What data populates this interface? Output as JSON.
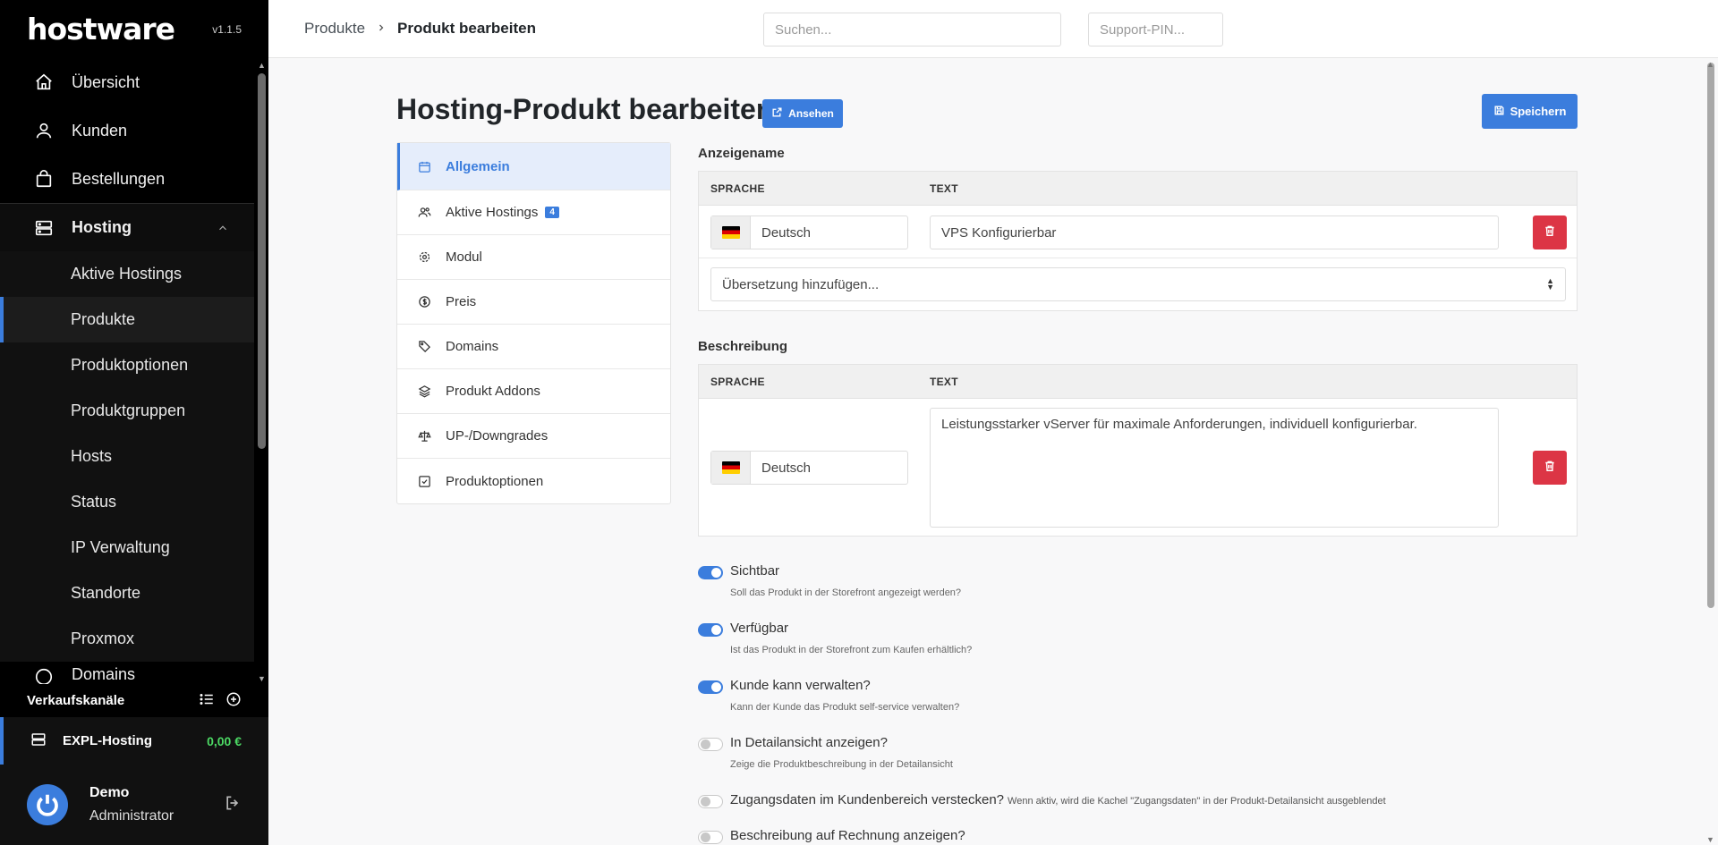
{
  "app": {
    "logo": "hostware",
    "version": "v1.1.5"
  },
  "sidebar": {
    "items": [
      {
        "label": "Übersicht",
        "icon": "home-icon"
      },
      {
        "label": "Kunden",
        "icon": "user-icon"
      },
      {
        "label": "Bestellungen",
        "icon": "shopping-bag-icon"
      }
    ],
    "group": {
      "label": "Hosting",
      "icon": "server-icon"
    },
    "sub_items": [
      {
        "label": "Aktive Hostings"
      },
      {
        "label": "Produkte",
        "active": true
      },
      {
        "label": "Produktoptionen"
      },
      {
        "label": "Produktgruppen"
      },
      {
        "label": "Hosts"
      },
      {
        "label": "Status"
      },
      {
        "label": "IP Verwaltung"
      },
      {
        "label": "Standorte"
      },
      {
        "label": "Proxmox"
      },
      {
        "label": "Domains"
      }
    ],
    "channels_title": "Verkaufskanäle",
    "channel": {
      "name": "EXPL-Hosting",
      "balance": "0,00 €"
    },
    "user": {
      "name": "Demo",
      "role": "Administrator"
    }
  },
  "topbar": {
    "breadcrumb": {
      "parent": "Produkte",
      "current": "Produkt bearbeiten"
    },
    "search_placeholder": "Suchen...",
    "pin_placeholder": "Support-PIN..."
  },
  "page": {
    "title": "Hosting-Produkt bearbeiten",
    "view_label": "Ansehen",
    "save_label": "Speichern"
  },
  "tabs": [
    {
      "label": "Allgemein",
      "icon": "calendar-icon",
      "active": true
    },
    {
      "label": "Aktive Hostings",
      "icon": "users-icon",
      "badge": "4"
    },
    {
      "label": "Modul",
      "icon": "cog-icon"
    },
    {
      "label": "Preis",
      "icon": "dollar-icon"
    },
    {
      "label": "Domains",
      "icon": "tag-icon"
    },
    {
      "label": "Produkt Addons",
      "icon": "layers-icon"
    },
    {
      "label": "UP-/Downgrades",
      "icon": "scale-icon"
    },
    {
      "label": "Produktoptionen",
      "icon": "checkbox-icon"
    }
  ],
  "display_name": {
    "title": "Anzeigename",
    "col_lang": "SPRACHE",
    "col_text": "TEXT",
    "row": {
      "language": "Deutsch",
      "text": "VPS Konfigurierbar"
    },
    "add_translation": "Übersetzung hinzufügen..."
  },
  "description": {
    "title": "Beschreibung",
    "col_lang": "SPRACHE",
    "col_text": "TEXT",
    "row": {
      "language": "Deutsch",
      "text": "Leistungsstarker vServer für maximale Anforderungen, individuell konfigurierbar."
    }
  },
  "toggles": [
    {
      "label": "Sichtbar",
      "help": "Soll das Produkt in der Storefront angezeigt werden?",
      "on": true
    },
    {
      "label": "Verfügbar",
      "help": "Ist das Produkt in der Storefront zum Kaufen erhältlich?",
      "on": true
    },
    {
      "label": "Kunde kann verwalten?",
      "help": "Kann der Kunde das Produkt self-service verwalten?",
      "on": true
    },
    {
      "label": "In Detailansicht anzeigen?",
      "help": "Zeige die Produktbeschreibung in der Detailansicht",
      "on": false
    },
    {
      "label": "Zugangsdaten im Kundenbereich verstecken?",
      "inline_help": "Wenn aktiv, wird die Kachel \"Zugangsdaten\" in der Produkt-Detailansicht ausgeblendet",
      "on": false
    },
    {
      "label": "Beschreibung auf Rechnung anzeigen?",
      "on": false
    }
  ],
  "colors": {
    "accent": "#3b7ddd",
    "danger": "#dc3545",
    "sidebar": "#000000"
  }
}
